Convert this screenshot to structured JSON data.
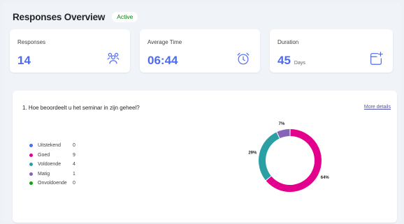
{
  "header": {
    "title": "Responses Overview",
    "status": "Active"
  },
  "cards": [
    {
      "label": "Responses",
      "value": "14",
      "unit": "",
      "icon": "people-icon"
    },
    {
      "label": "Average Time",
      "value": "06:44",
      "unit": "",
      "icon": "alarm-clock-icon"
    },
    {
      "label": "Duration",
      "value": "45",
      "unit": "Days",
      "icon": "calendar-add-icon"
    }
  ],
  "question": {
    "text": "1. Hoe beoordeelt u het seminar in zijn geheel?",
    "more_link": "More details",
    "options": [
      {
        "label": "Uitstekend",
        "count": "0",
        "color": "#4f6bed"
      },
      {
        "label": "Goed",
        "count": "9",
        "color": "#e3008c"
      },
      {
        "label": "Voldoende",
        "count": "4",
        "color": "#2aa0a4"
      },
      {
        "label": "Matig",
        "count": "1",
        "color": "#8764b8"
      },
      {
        "label": "Onvoldoende",
        "count": "0",
        "color": "#13a10e"
      }
    ]
  },
  "chart_data": {
    "type": "pie",
    "categories": [
      "Goed",
      "Voldoende",
      "Matig"
    ],
    "values": [
      64,
      29,
      7
    ],
    "labels": [
      "64%",
      "29%",
      "7%"
    ],
    "colors": [
      "#e3008c",
      "#2aa0a4",
      "#8764b8"
    ]
  }
}
